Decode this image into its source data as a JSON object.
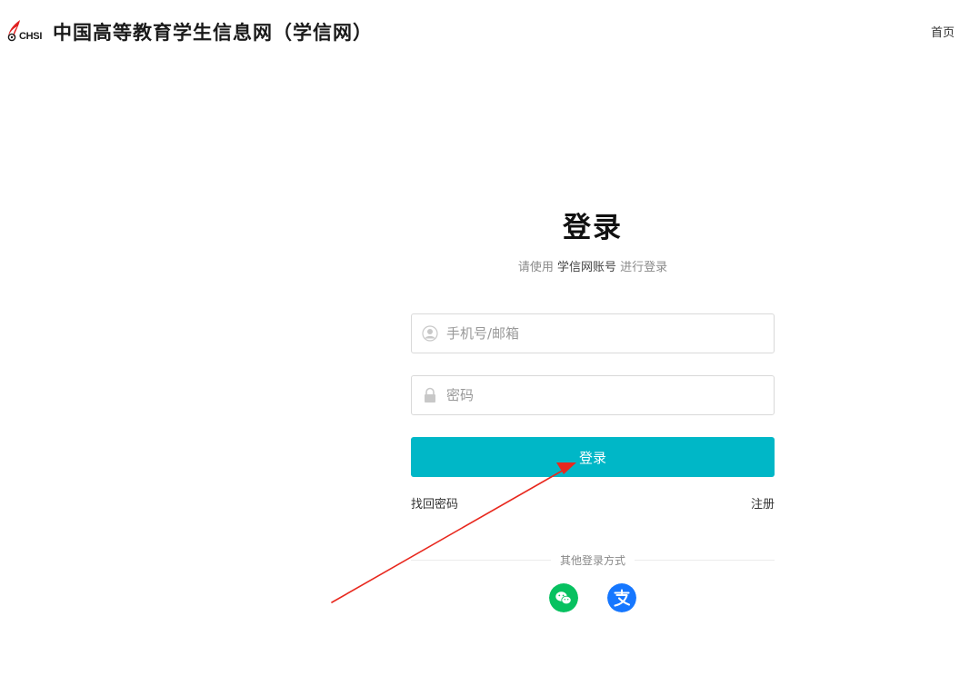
{
  "header": {
    "logo_text": "CHSI",
    "site_title": "中国高等教育学生信息网（学信网）",
    "home_link": "首页"
  },
  "login": {
    "title": "登录",
    "subtitle_prefix": "请使用",
    "subtitle_highlight": "学信网账号",
    "subtitle_suffix": "进行登录",
    "username_placeholder": "手机号/邮箱",
    "password_placeholder": "密码",
    "login_button": "登录",
    "forgot_password": "找回密码",
    "register": "注册",
    "other_methods": "其他登录方式"
  },
  "colors": {
    "accent": "#00b7c7",
    "wechat": "#07c160",
    "alipay": "#1677ff",
    "annotation_arrow": "#e8281e"
  },
  "icons": {
    "user": "user-icon",
    "password": "lock-icon",
    "wechat": "wechat-icon",
    "alipay": "alipay-icon"
  }
}
